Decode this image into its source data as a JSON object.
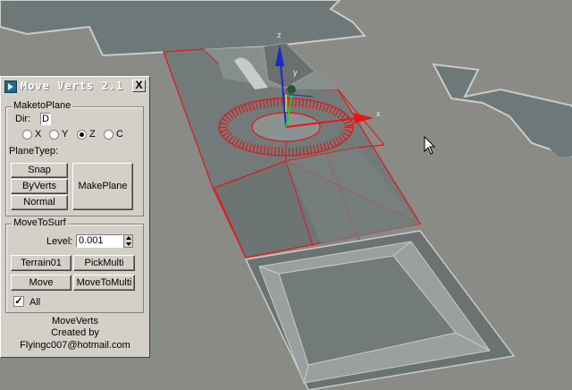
{
  "window": {
    "title": "Move Verts 2.1",
    "close_glyph": "X"
  },
  "make_to_plane": {
    "group_label": "MaketoPlane",
    "dir_label": "Dir:",
    "dir_value": "D",
    "axes": [
      {
        "label": "X",
        "checked": false
      },
      {
        "label": "Y",
        "checked": false
      },
      {
        "label": "Z",
        "checked": true
      },
      {
        "label": "C",
        "checked": false
      }
    ],
    "plane_type_label": "PlaneTyep:",
    "snap_label": "Snap",
    "byverts_label": "ByVerts",
    "normal_label": "Normal",
    "makeplane_label": "MakePlane"
  },
  "move_to_surf": {
    "group_label": "MoveToSurf",
    "level_label": "Level:",
    "level_value": "0.001",
    "terrain_label": "Terrain01",
    "pickmulti_label": "PickMulti",
    "move_label": "Move",
    "movetomulti_label": "MoveToMulti",
    "all_label": "All",
    "all_checked": true
  },
  "credits": {
    "line1": "MoveVerts",
    "line2": "Created by",
    "line3": "Flyingc007@hotmail.com"
  },
  "viewport": {
    "background": "#8a8a87",
    "gizmo_x_label": "x",
    "gizmo_y_label": "y",
    "gizmo_z_label": "z",
    "selection_color": "#e01818",
    "cursor_icon": "arrow-cursor-icon"
  }
}
